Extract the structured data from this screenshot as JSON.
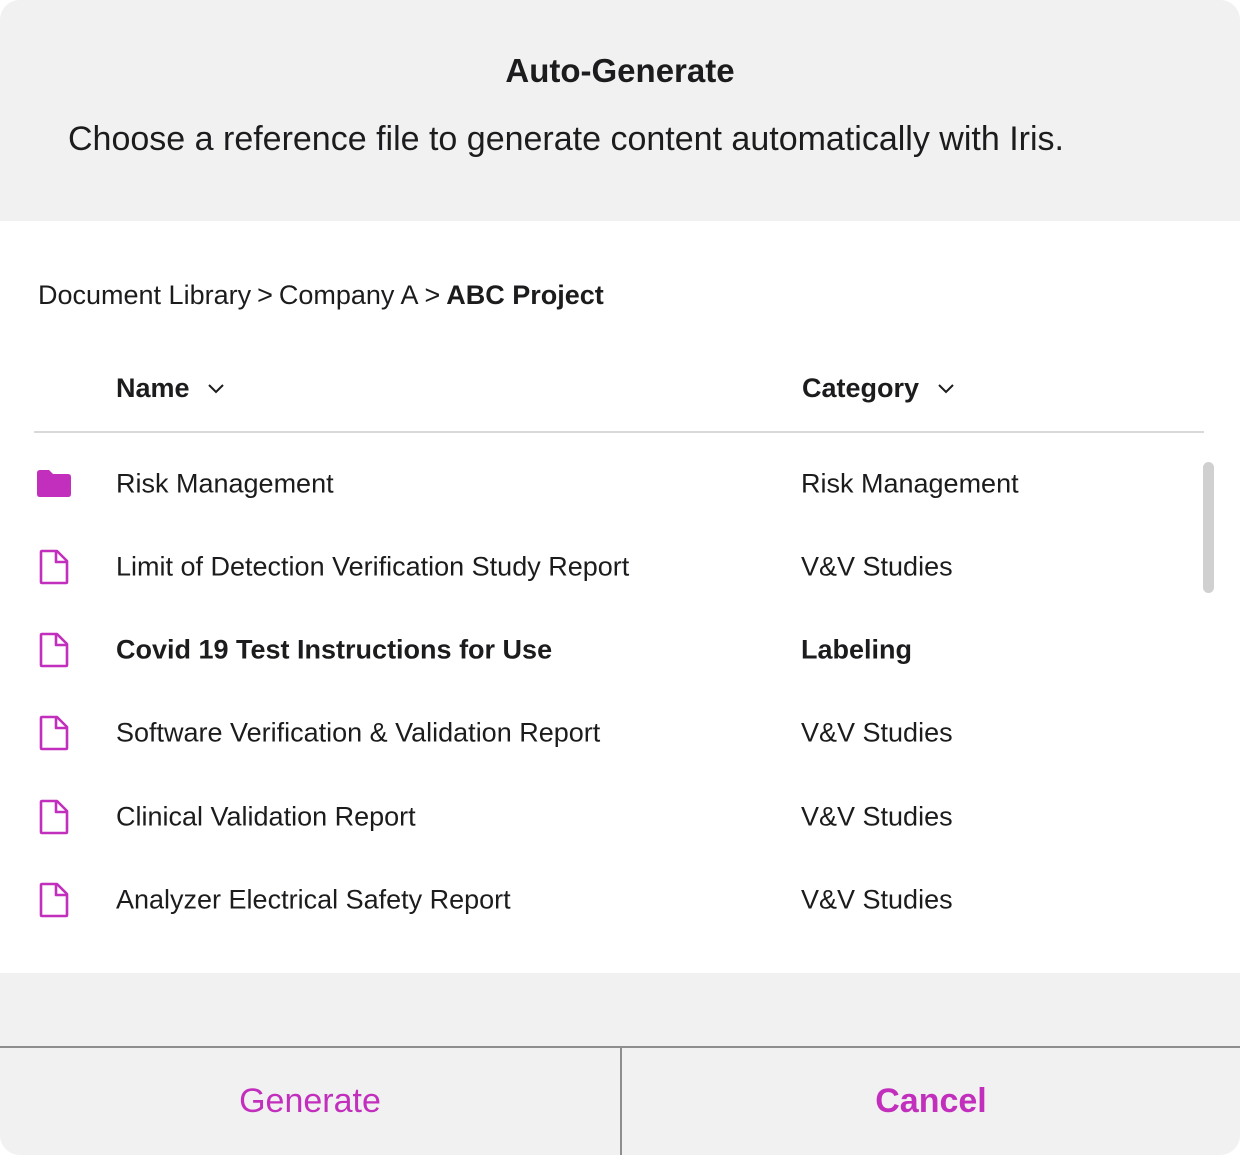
{
  "dialog": {
    "title": "Auto-Generate",
    "subtitle": "Choose a reference file to generate content automatically with Iris."
  },
  "breadcrumb": {
    "items": [
      "Document Library",
      "Company A"
    ],
    "separator": ">",
    "current": "ABC Project"
  },
  "table": {
    "columns": [
      {
        "label": "Name",
        "icon": "chevron-down-icon"
      },
      {
        "label": "Category",
        "icon": "chevron-down-icon"
      }
    ],
    "rows": [
      {
        "name": "Risk Management",
        "category": "Risk Management",
        "icon": "folder-icon",
        "selected": false
      },
      {
        "name": "Limit of Detection Verification Study Report",
        "category": "V&V Studies",
        "icon": "file-icon",
        "selected": false
      },
      {
        "name": "Covid 19 Test Instructions for Use",
        "category": "Labeling",
        "icon": "file-icon",
        "selected": true
      },
      {
        "name": "Software Verification & Validation Report",
        "category": "V&V Studies",
        "icon": "file-icon",
        "selected": false
      },
      {
        "name": "Clinical Validation Report",
        "category": "V&V Studies",
        "icon": "file-icon",
        "selected": false
      },
      {
        "name": "Analyzer Electrical Safety Report",
        "category": "V&V Studies",
        "icon": "file-icon",
        "selected": false
      }
    ]
  },
  "footer": {
    "generate_label": "Generate",
    "cancel_label": "Cancel"
  },
  "colors": {
    "accent": "#c22fbd",
    "header_bg": "#f1f1f1",
    "body_bg": "#ffffff",
    "text": "#1c1c1e"
  }
}
